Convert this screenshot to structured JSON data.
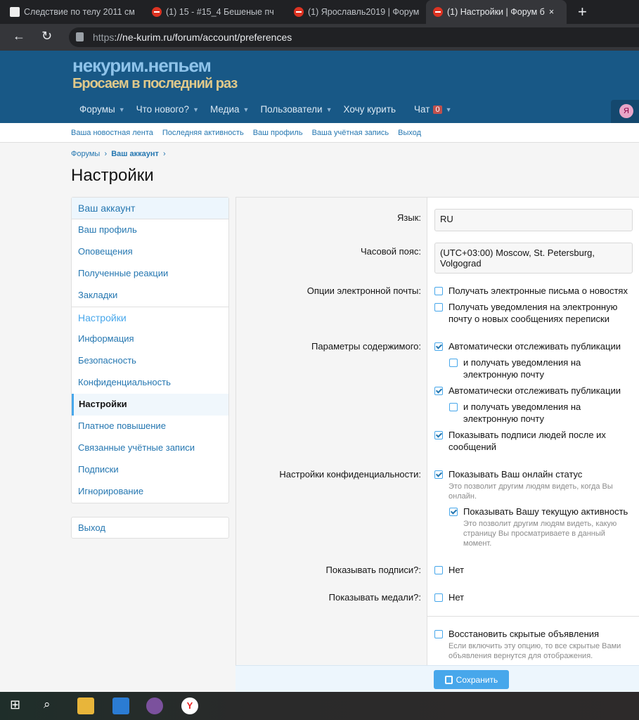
{
  "browser": {
    "tabs": [
      "Следствие по телу 2011 см",
      "(1) 15 - #15_4 Бешеные пч",
      "(1) Ярославль2019 | Форум",
      "(1) Настройки | Форум б"
    ],
    "url_prefix": "https",
    "url_rest": "://ne-kurim.ru/forum/account/preferences",
    "new_tab": "+",
    "close": "×"
  },
  "header": {
    "logo_line1": "некурим.непьем",
    "logo_line2": "Бросаем в последний раз",
    "nav": [
      "Форумы",
      "Что нового?",
      "Медиа",
      "Пользователи",
      "Хочу курить",
      "Чат"
    ],
    "chat_count": "0",
    "avatar_letter": "Я"
  },
  "subnav": [
    "Ваша новостная лента",
    "Последняя активность",
    "Ваш профиль",
    "Ваша учётная запись",
    "Выход"
  ],
  "breadcrumb": [
    "Форумы",
    "Ваш аккаунт"
  ],
  "page_title": "Настройки",
  "sidebar": {
    "head1": "Ваш аккаунт",
    "group1": [
      "Ваш профиль",
      "Оповещения",
      "Полученные реакции",
      "Закладки"
    ],
    "head2": "Настройки",
    "group2": [
      "Информация",
      "Безопасность",
      "Конфиденциальность",
      "Настройки",
      "Платное повышение",
      "Связанные учётные записи",
      "Подписки",
      "Игнорирование"
    ],
    "logout": "Выход"
  },
  "form": {
    "language_label": "Язык:",
    "language_value": "RU",
    "timezone_label": "Часовой пояс:",
    "timezone_value": "(UTC+03:00) Moscow, St. Petersburg, Volgograd",
    "email_label": "Опции электронной почты:",
    "email_opt1": "Получать электронные письма о новостях",
    "email_opt2": "Получать уведомления на электронную почту о новых сообщениях",
    "email_opt2b": "переписки",
    "content_label": "Параметры содержимого:",
    "content_opt1": "Автоматически отслеживать публикации",
    "content_opt1a": "и получать уведомления на электронную почту",
    "content_opt2": "Автоматически отслеживать публикации",
    "content_opt2a": "и получать уведомления на электронную почту",
    "content_opt3": "Показывать подписи людей после их сообщений",
    "privacy_label": "Настройки конфиденциальности:",
    "privacy_opt1": "Показывать Ваш онлайн статус",
    "privacy_hint1": "Это позволит другим людям видеть, когда Вы онлайн.",
    "privacy_opt2": "Показывать Вашу текущую активность",
    "privacy_hint2": "Это позволит другим людям видеть, какую страницу Вы просматриваете в данный",
    "privacy_hint2b": "момент.",
    "signatures_label": "Показывать подписи?:",
    "signatures_value": "Нет",
    "medals_label": "Показывать медали?:",
    "medals_value": "Нет",
    "restore_opt": "Восстановить скрытые объявления",
    "restore_hint": "Если включить эту опцию, то все скрытые Вами объявления вернутся для",
    "restore_hint2": "отображения."
  },
  "save_label": "Сохранить"
}
